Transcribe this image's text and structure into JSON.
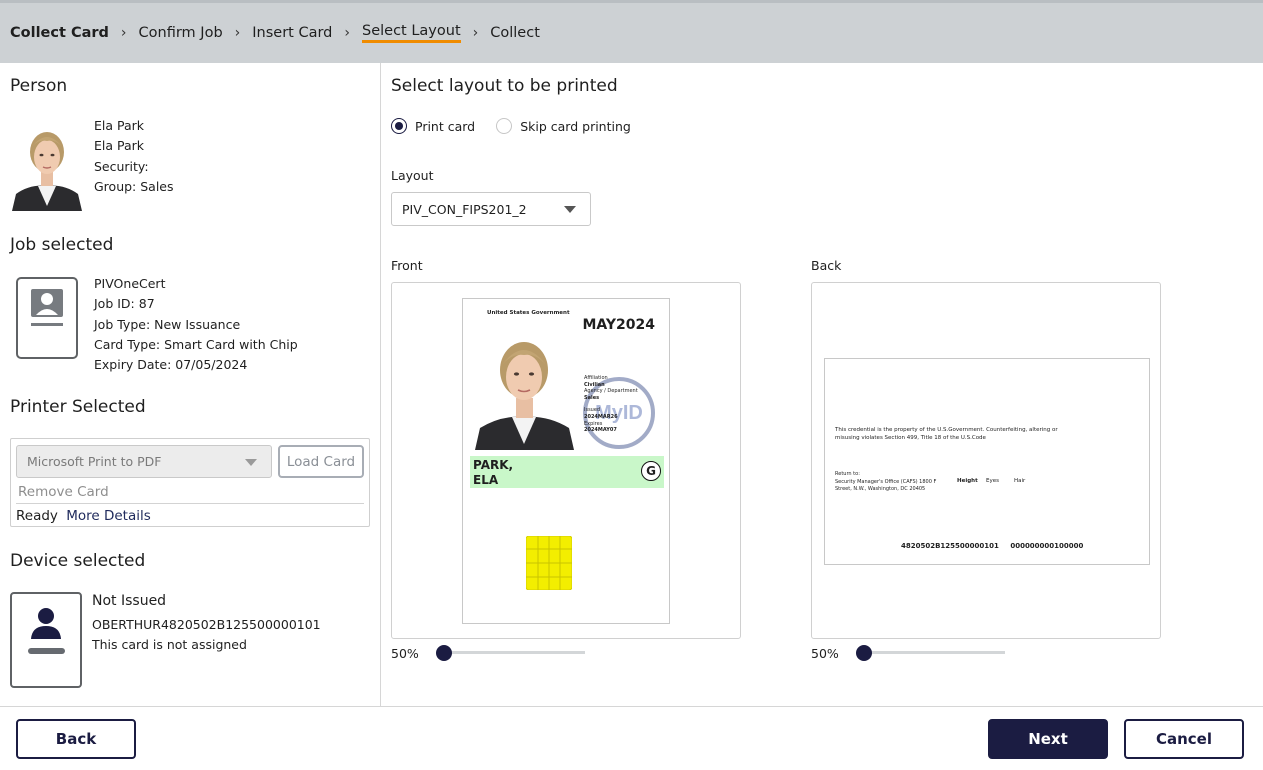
{
  "breadcrumb": [
    "Collect Card",
    "Confirm Job",
    "Insert Card",
    "Select Layout",
    "Collect"
  ],
  "person": {
    "heading": "Person",
    "name1": "Ela Park",
    "name2": "Ela Park",
    "security": "Security:",
    "group": "Group: Sales"
  },
  "job": {
    "heading": "Job selected",
    "name": "PIVOneCert",
    "id": "Job ID: 87",
    "type": "Job Type: New Issuance",
    "card_type": "Card Type: Smart Card with Chip",
    "expiry": "Expiry Date: 07/05/2024"
  },
  "printer": {
    "heading": "Printer Selected",
    "selected": "Microsoft Print to PDF",
    "load_label": "Load Card",
    "remove_label": "Remove Card",
    "status": "Ready",
    "details_label": "More Details"
  },
  "device": {
    "heading": "Device selected",
    "status": "Not Issued",
    "serial": "OBERTHUR4820502B125500000101",
    "note": "This card is not assigned"
  },
  "layout": {
    "heading": "Select layout to be printed",
    "option_print": "Print card",
    "option_skip": "Skip card printing",
    "label": "Layout",
    "selected": "PIV_CON_FIPS201_2",
    "front_label": "Front",
    "back_label": "Back",
    "front_zoom": "50%",
    "back_zoom": "50%",
    "front_zoom_value": 0,
    "back_zoom_value": 0
  },
  "card_front": {
    "gov": "United States Government",
    "date": "MAY2024",
    "affiliation_label": "Affiliation",
    "affiliation": "Civilian",
    "agency_label": "Agency / Department",
    "agency": "Sales",
    "issued_label": "Issued",
    "issued": "2024MAR26",
    "expires_label": "Expires",
    "expires": "2024MAY07",
    "logo": "MyID",
    "last": "PARK,",
    "first": "ELA",
    "badge": "G"
  },
  "card_back": {
    "notice": "This credential is the property of the U.S.Government. Counterfeiting, altering or misusing violates Section 499, Title 18 of the U.S.Code",
    "return_to": "Return to:",
    "address1": "Security Manager's Office (CAFS) 1800 F",
    "address2": "Street, N.W., Washington, DC 20405",
    "height": "Height",
    "eyes": "Eyes",
    "hair": "Hair",
    "code1": "4820502B125500000101",
    "code2": "000000000100000"
  },
  "footer": {
    "back_label": "Back",
    "next_label": "Next",
    "cancel_label": "Cancel"
  },
  "colors": {
    "accent": "#1b1c42",
    "highlight": "#f08c00",
    "name_band": "#c9f7c9",
    "chip": "#f3ee00"
  }
}
